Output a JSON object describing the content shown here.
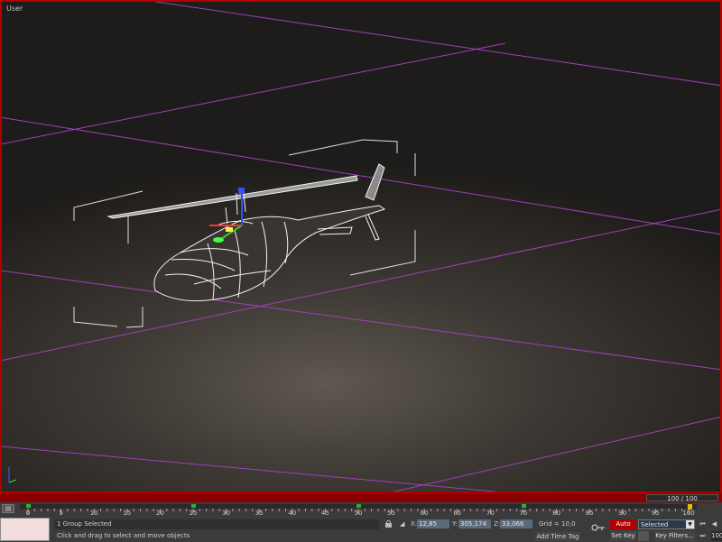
{
  "viewport": {
    "label": "User"
  },
  "timeline": {
    "slider_text": "100 / 100",
    "tick_labels": [
      "0",
      "5",
      "10",
      "15",
      "20",
      "25",
      "30",
      "35",
      "40",
      "45",
      "50",
      "55",
      "60",
      "65",
      "70",
      "75",
      "80",
      "85",
      "90",
      "95",
      "100"
    ]
  },
  "status": {
    "selection_text": "1 Group Selected",
    "prompt_text": "Click and drag to select and move objects",
    "x_label": "X:",
    "x_value": "12,85",
    "y_label": "Y:",
    "y_value": "305,174",
    "z_label": "Z:",
    "z_value": "33,066",
    "grid_text": "Grid = 10,0",
    "time_tag": "Add Time Tag"
  },
  "anim": {
    "auto_key": "Auto Key",
    "set_key": "Set Key",
    "selected": "Selected",
    "key_filters": "Key Filters...",
    "frame": "100"
  },
  "colors": {
    "accent_red": "#b00000",
    "grid_purple": "#b040c0"
  }
}
